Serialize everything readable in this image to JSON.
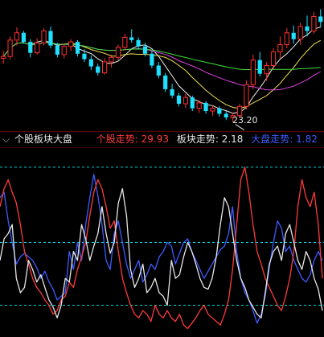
{
  "kline": {
    "low_label": "23.20",
    "candles": [
      [
        30.2,
        31.0,
        29.6,
        30.4
      ],
      [
        30.4,
        32.6,
        30.1,
        32.2
      ],
      [
        32.2,
        33.6,
        31.6,
        33.0
      ],
      [
        33.0,
        33.2,
        31.8,
        32.0
      ],
      [
        32.0,
        32.3,
        30.3,
        30.8
      ],
      [
        30.8,
        32.4,
        30.6,
        31.9
      ],
      [
        31.9,
        33.5,
        31.6,
        33.2
      ],
      [
        33.2,
        33.7,
        31.3,
        31.6
      ],
      [
        31.6,
        31.9,
        30.3,
        30.6
      ],
      [
        30.6,
        31.8,
        30.2,
        31.5
      ],
      [
        31.5,
        32.3,
        31.0,
        32.0
      ],
      [
        32.0,
        32.2,
        30.4,
        30.7
      ],
      [
        30.7,
        31.2,
        29.8,
        30.1
      ],
      [
        30.1,
        30.5,
        28.9,
        29.3
      ],
      [
        29.3,
        29.6,
        28.3,
        28.6
      ],
      [
        28.6,
        30.2,
        28.4,
        29.8
      ],
      [
        29.8,
        30.6,
        29.2,
        30.3
      ],
      [
        30.3,
        31.7,
        30.0,
        31.4
      ],
      [
        31.4,
        32.9,
        31.1,
        32.5
      ],
      [
        32.5,
        33.4,
        31.9,
        32.2
      ],
      [
        32.2,
        32.5,
        31.2,
        31.5
      ],
      [
        31.5,
        31.9,
        30.4,
        30.7
      ],
      [
        30.7,
        31.0,
        29.1,
        29.4
      ],
      [
        29.4,
        29.8,
        28.0,
        28.3
      ],
      [
        28.3,
        28.6,
        26.5,
        26.8
      ],
      [
        26.8,
        27.4,
        25.8,
        26.1
      ],
      [
        26.1,
        26.4,
        24.9,
        25.2
      ],
      [
        25.2,
        26.3,
        24.7,
        25.9
      ],
      [
        25.9,
        26.1,
        24.4,
        24.7
      ],
      [
        24.7,
        25.6,
        24.2,
        25.3
      ],
      [
        25.3,
        25.5,
        24.1,
        24.4
      ],
      [
        24.4,
        25.0,
        23.9,
        24.7
      ],
      [
        24.7,
        24.9,
        23.8,
        24.1
      ],
      [
        24.1,
        24.4,
        23.4,
        23.7
      ],
      [
        23.7,
        24.2,
        23.2,
        23.9
      ],
      [
        23.9,
        25.2,
        23.7,
        24.9
      ],
      [
        24.9,
        27.8,
        24.6,
        27.3
      ],
      [
        27.3,
        30.6,
        26.8,
        30.0
      ],
      [
        30.0,
        30.9,
        28.2,
        28.5
      ],
      [
        28.5,
        29.8,
        27.7,
        29.4
      ],
      [
        29.4,
        31.3,
        29.0,
        30.9
      ],
      [
        30.9,
        32.6,
        30.2,
        31.7
      ],
      [
        31.7,
        33.5,
        31.3,
        33.0
      ],
      [
        33.0,
        33.8,
        31.8,
        32.3
      ],
      [
        32.3,
        34.1,
        31.7,
        33.7
      ],
      [
        33.7,
        34.9,
        32.6,
        33.2
      ],
      [
        33.2,
        35.3,
        32.9,
        34.8
      ],
      [
        34.8,
        35.6,
        33.6,
        34.2
      ]
    ]
  },
  "header": {
    "indicator_name": "个股板块大盘",
    "series": [
      {
        "label": "个股走势:",
        "value": "29.93"
      },
      {
        "label": "板块走势:",
        "value": "2.18"
      },
      {
        "label": "大盘走势:",
        "value": "1.82"
      }
    ]
  },
  "chart_data": {
    "type": "line",
    "x": [
      0,
      1,
      2,
      3,
      4,
      5,
      6,
      7,
      8,
      9,
      10,
      11,
      12,
      13,
      14,
      15,
      16,
      17,
      18,
      19,
      20,
      21,
      22,
      23,
      24,
      25,
      26,
      27,
      28,
      29,
      30,
      31,
      32,
      33,
      34,
      35,
      36,
      37,
      38,
      39,
      40,
      41,
      42,
      43,
      44,
      45,
      46,
      47,
      48,
      49,
      50,
      51,
      52,
      53,
      54,
      55,
      56,
      57,
      58,
      59,
      60,
      61,
      62,
      63,
      64,
      65,
      66,
      67,
      68,
      69,
      70,
      71,
      72,
      73,
      74,
      75,
      76,
      77,
      78,
      79
    ],
    "series": [
      {
        "name": "个股走势",
        "color": "#ff3b3b",
        "values": [
          70,
          80,
          85,
          78,
          72,
          60,
          45,
          38,
          30,
          25,
          22,
          18,
          15,
          10,
          12,
          18,
          20,
          28,
          25,
          35,
          42,
          50,
          65,
          78,
          85,
          80,
          70,
          58,
          62,
          45,
          30,
          22,
          15,
          10,
          8,
          12,
          10,
          6,
          15,
          10,
          8,
          12,
          8,
          6,
          10,
          4,
          2,
          5,
          8,
          12,
          15,
          10,
          8,
          6,
          4,
          10,
          18,
          35,
          60,
          85,
          92,
          78,
          60,
          45,
          38,
          30,
          25,
          20,
          15,
          12,
          20,
          30,
          45,
          70,
          85,
          75,
          70,
          78,
          60,
          30
        ]
      },
      {
        "name": "板块走势",
        "color": "#e6e6e6",
        "values": [
          40,
          52,
          55,
          60,
          30,
          22,
          25,
          40,
          35,
          28,
          32,
          25,
          18,
          14,
          8,
          15,
          30,
          28,
          45,
          40,
          60,
          52,
          40,
          48,
          55,
          70,
          55,
          44,
          50,
          72,
          80,
          65,
          35,
          25,
          30,
          38,
          22,
          25,
          30,
          22,
          20,
          15,
          40,
          30,
          32,
          42,
          50,
          45,
          38,
          30,
          25,
          24,
          30,
          42,
          60,
          75,
          70,
          55,
          40,
          30,
          25,
          18,
          14,
          10,
          8,
          22,
          38,
          45,
          48,
          40,
          55,
          60,
          50,
          40,
          35,
          45,
          40,
          30,
          24,
          12
        ]
      },
      {
        "name": "大盘走势",
        "color": "#3d5cff",
        "values": [
          75,
          78,
          62,
          50,
          38,
          42,
          44,
          42,
          40,
          36,
          30,
          34,
          28,
          24,
          18,
          20,
          22,
          45,
          35,
          50,
          40,
          60,
          75,
          88,
          76,
          60,
          40,
          35,
          55,
          62,
          50,
          38,
          30,
          35,
          40,
          28,
          32,
          38,
          35,
          42,
          45,
          50,
          48,
          38,
          44,
          50,
          52,
          45,
          40,
          35,
          30,
          34,
          38,
          42,
          46,
          48,
          55,
          70,
          45,
          30,
          22,
          18,
          12,
          5,
          10,
          20,
          36,
          50,
          62,
          58,
          45,
          48,
          40,
          35,
          30,
          28,
          32,
          40,
          45,
          40
        ]
      }
    ],
    "reference_lines": [
      {
        "value": 92,
        "color": "#00d8d8"
      },
      {
        "value": 50,
        "color": "#00d8d8"
      },
      {
        "value": 15,
        "color": "#00d8d8"
      }
    ],
    "ylim": [
      0,
      100
    ]
  }
}
